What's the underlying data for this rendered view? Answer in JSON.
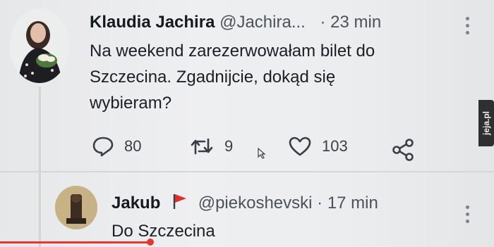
{
  "tweet": {
    "author_name": "Klaudia Jachira",
    "handle": "@Jachira...",
    "time": "· 23 min",
    "text_lines": [
      "Na weekend zarezerwowałam bilet do",
      "Szczecina. Zgadnijcie, dokąd się",
      "wybieram?"
    ],
    "actions": {
      "reply_count": "80",
      "retweet_count": "9",
      "like_count": "103"
    }
  },
  "reply": {
    "author_name": "Jakub",
    "handle": "@piekoshevski",
    "time": "· 17 min",
    "text": "Do Szczecina"
  },
  "watermark": {
    "text": "jeja.pl"
  },
  "colors": {
    "accent_red": "#e8352f",
    "text": "#1c1f24",
    "icon": "#3a3f45",
    "background": "#ecedef"
  },
  "icons": [
    "reply-icon",
    "retweet-icon",
    "like-icon",
    "share-icon",
    "more-icon",
    "flag-icon"
  ]
}
